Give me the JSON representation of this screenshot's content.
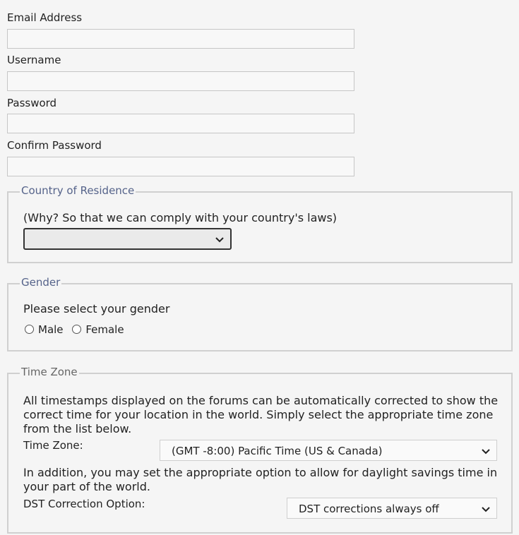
{
  "fields": {
    "email": {
      "label": "Email Address",
      "value": ""
    },
    "username": {
      "label": "Username",
      "value": ""
    },
    "password": {
      "label": "Password",
      "value": ""
    },
    "confirm_password": {
      "label": "Confirm Password",
      "value": ""
    }
  },
  "country": {
    "legend": "Country of Residence",
    "note": "(Why? So that we can comply with your country's laws)",
    "selected": ""
  },
  "gender": {
    "legend": "Gender",
    "prompt": "Please select your gender",
    "options": [
      "Male",
      "Female"
    ]
  },
  "timezone": {
    "legend": "Time Zone",
    "description": "All timestamps displayed on the forums can be automatically corrected to show the correct time for your location in the world. Simply select the appropriate time zone from the list below.",
    "label": "Time Zone:",
    "selected": "(GMT -8:00) Pacific Time (US & Canada)",
    "dst_description": "In addition, you may set the appropriate option to allow for daylight savings time in your part of the world.",
    "dst_label": "DST Correction Option:",
    "dst_selected": "DST corrections always off"
  },
  "icons": [
    "chevron-down-icon"
  ]
}
